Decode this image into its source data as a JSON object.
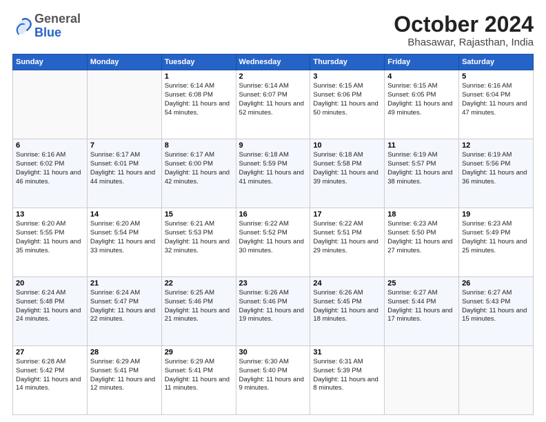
{
  "logo": {
    "general": "General",
    "blue": "Blue"
  },
  "header": {
    "month": "October 2024",
    "location": "Bhasawar, Rajasthan, India"
  },
  "weekdays": [
    "Sunday",
    "Monday",
    "Tuesday",
    "Wednesday",
    "Thursday",
    "Friday",
    "Saturday"
  ],
  "weeks": [
    [
      {
        "day": "",
        "info": ""
      },
      {
        "day": "",
        "info": ""
      },
      {
        "day": "1",
        "info": "Sunrise: 6:14 AM\nSunset: 6:08 PM\nDaylight: 11 hours and 54 minutes."
      },
      {
        "day": "2",
        "info": "Sunrise: 6:14 AM\nSunset: 6:07 PM\nDaylight: 11 hours and 52 minutes."
      },
      {
        "day": "3",
        "info": "Sunrise: 6:15 AM\nSunset: 6:06 PM\nDaylight: 11 hours and 50 minutes."
      },
      {
        "day": "4",
        "info": "Sunrise: 6:15 AM\nSunset: 6:05 PM\nDaylight: 11 hours and 49 minutes."
      },
      {
        "day": "5",
        "info": "Sunrise: 6:16 AM\nSunset: 6:04 PM\nDaylight: 11 hours and 47 minutes."
      }
    ],
    [
      {
        "day": "6",
        "info": "Sunrise: 6:16 AM\nSunset: 6:02 PM\nDaylight: 11 hours and 46 minutes."
      },
      {
        "day": "7",
        "info": "Sunrise: 6:17 AM\nSunset: 6:01 PM\nDaylight: 11 hours and 44 minutes."
      },
      {
        "day": "8",
        "info": "Sunrise: 6:17 AM\nSunset: 6:00 PM\nDaylight: 11 hours and 42 minutes."
      },
      {
        "day": "9",
        "info": "Sunrise: 6:18 AM\nSunset: 5:59 PM\nDaylight: 11 hours and 41 minutes."
      },
      {
        "day": "10",
        "info": "Sunrise: 6:18 AM\nSunset: 5:58 PM\nDaylight: 11 hours and 39 minutes."
      },
      {
        "day": "11",
        "info": "Sunrise: 6:19 AM\nSunset: 5:57 PM\nDaylight: 11 hours and 38 minutes."
      },
      {
        "day": "12",
        "info": "Sunrise: 6:19 AM\nSunset: 5:56 PM\nDaylight: 11 hours and 36 minutes."
      }
    ],
    [
      {
        "day": "13",
        "info": "Sunrise: 6:20 AM\nSunset: 5:55 PM\nDaylight: 11 hours and 35 minutes."
      },
      {
        "day": "14",
        "info": "Sunrise: 6:20 AM\nSunset: 5:54 PM\nDaylight: 11 hours and 33 minutes."
      },
      {
        "day": "15",
        "info": "Sunrise: 6:21 AM\nSunset: 5:53 PM\nDaylight: 11 hours and 32 minutes."
      },
      {
        "day": "16",
        "info": "Sunrise: 6:22 AM\nSunset: 5:52 PM\nDaylight: 11 hours and 30 minutes."
      },
      {
        "day": "17",
        "info": "Sunrise: 6:22 AM\nSunset: 5:51 PM\nDaylight: 11 hours and 29 minutes."
      },
      {
        "day": "18",
        "info": "Sunrise: 6:23 AM\nSunset: 5:50 PM\nDaylight: 11 hours and 27 minutes."
      },
      {
        "day": "19",
        "info": "Sunrise: 6:23 AM\nSunset: 5:49 PM\nDaylight: 11 hours and 25 minutes."
      }
    ],
    [
      {
        "day": "20",
        "info": "Sunrise: 6:24 AM\nSunset: 5:48 PM\nDaylight: 11 hours and 24 minutes."
      },
      {
        "day": "21",
        "info": "Sunrise: 6:24 AM\nSunset: 5:47 PM\nDaylight: 11 hours and 22 minutes."
      },
      {
        "day": "22",
        "info": "Sunrise: 6:25 AM\nSunset: 5:46 PM\nDaylight: 11 hours and 21 minutes."
      },
      {
        "day": "23",
        "info": "Sunrise: 6:26 AM\nSunset: 5:46 PM\nDaylight: 11 hours and 19 minutes."
      },
      {
        "day": "24",
        "info": "Sunrise: 6:26 AM\nSunset: 5:45 PM\nDaylight: 11 hours and 18 minutes."
      },
      {
        "day": "25",
        "info": "Sunrise: 6:27 AM\nSunset: 5:44 PM\nDaylight: 11 hours and 17 minutes."
      },
      {
        "day": "26",
        "info": "Sunrise: 6:27 AM\nSunset: 5:43 PM\nDaylight: 11 hours and 15 minutes."
      }
    ],
    [
      {
        "day": "27",
        "info": "Sunrise: 6:28 AM\nSunset: 5:42 PM\nDaylight: 11 hours and 14 minutes."
      },
      {
        "day": "28",
        "info": "Sunrise: 6:29 AM\nSunset: 5:41 PM\nDaylight: 11 hours and 12 minutes."
      },
      {
        "day": "29",
        "info": "Sunrise: 6:29 AM\nSunset: 5:41 PM\nDaylight: 11 hours and 11 minutes."
      },
      {
        "day": "30",
        "info": "Sunrise: 6:30 AM\nSunset: 5:40 PM\nDaylight: 11 hours and 9 minutes."
      },
      {
        "day": "31",
        "info": "Sunrise: 6:31 AM\nSunset: 5:39 PM\nDaylight: 11 hours and 8 minutes."
      },
      {
        "day": "",
        "info": ""
      },
      {
        "day": "",
        "info": ""
      }
    ]
  ]
}
